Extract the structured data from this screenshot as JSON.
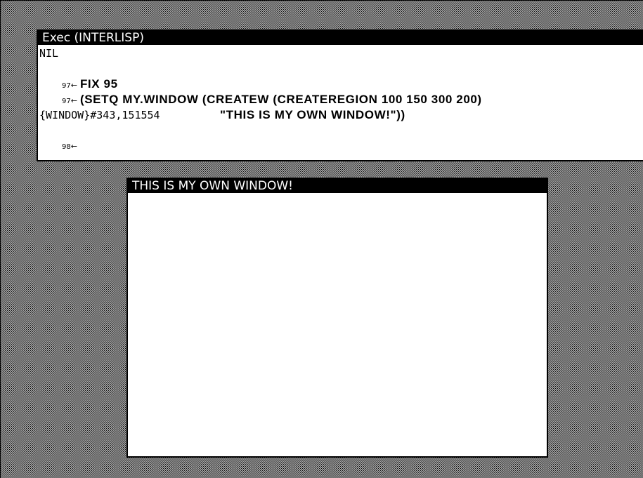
{
  "exec_window": {
    "title": "Exec (INTERLISP)",
    "lines": {
      "nil_output": "NIL",
      "prompt_97": "97",
      "prompt_98": "98",
      "prompt_arrow": "←",
      "fix_cmd": "FIX 95",
      "setq_cmd": "(SETQ MY.WINDOW (CREATEW (CREATEREGION 100 150 300 200)",
      "setq_cont": "\"THIS IS MY OWN WINDOW!\"))",
      "window_output": "{WINDOW}#343,151554"
    }
  },
  "my_window": {
    "title": "THIS IS MY OWN WINDOW!"
  },
  "colors": {
    "background_pattern": "#000000/#ffffff stipple",
    "title_bar": "#000000",
    "title_text": "#ffffff",
    "window_body": "#ffffff"
  }
}
